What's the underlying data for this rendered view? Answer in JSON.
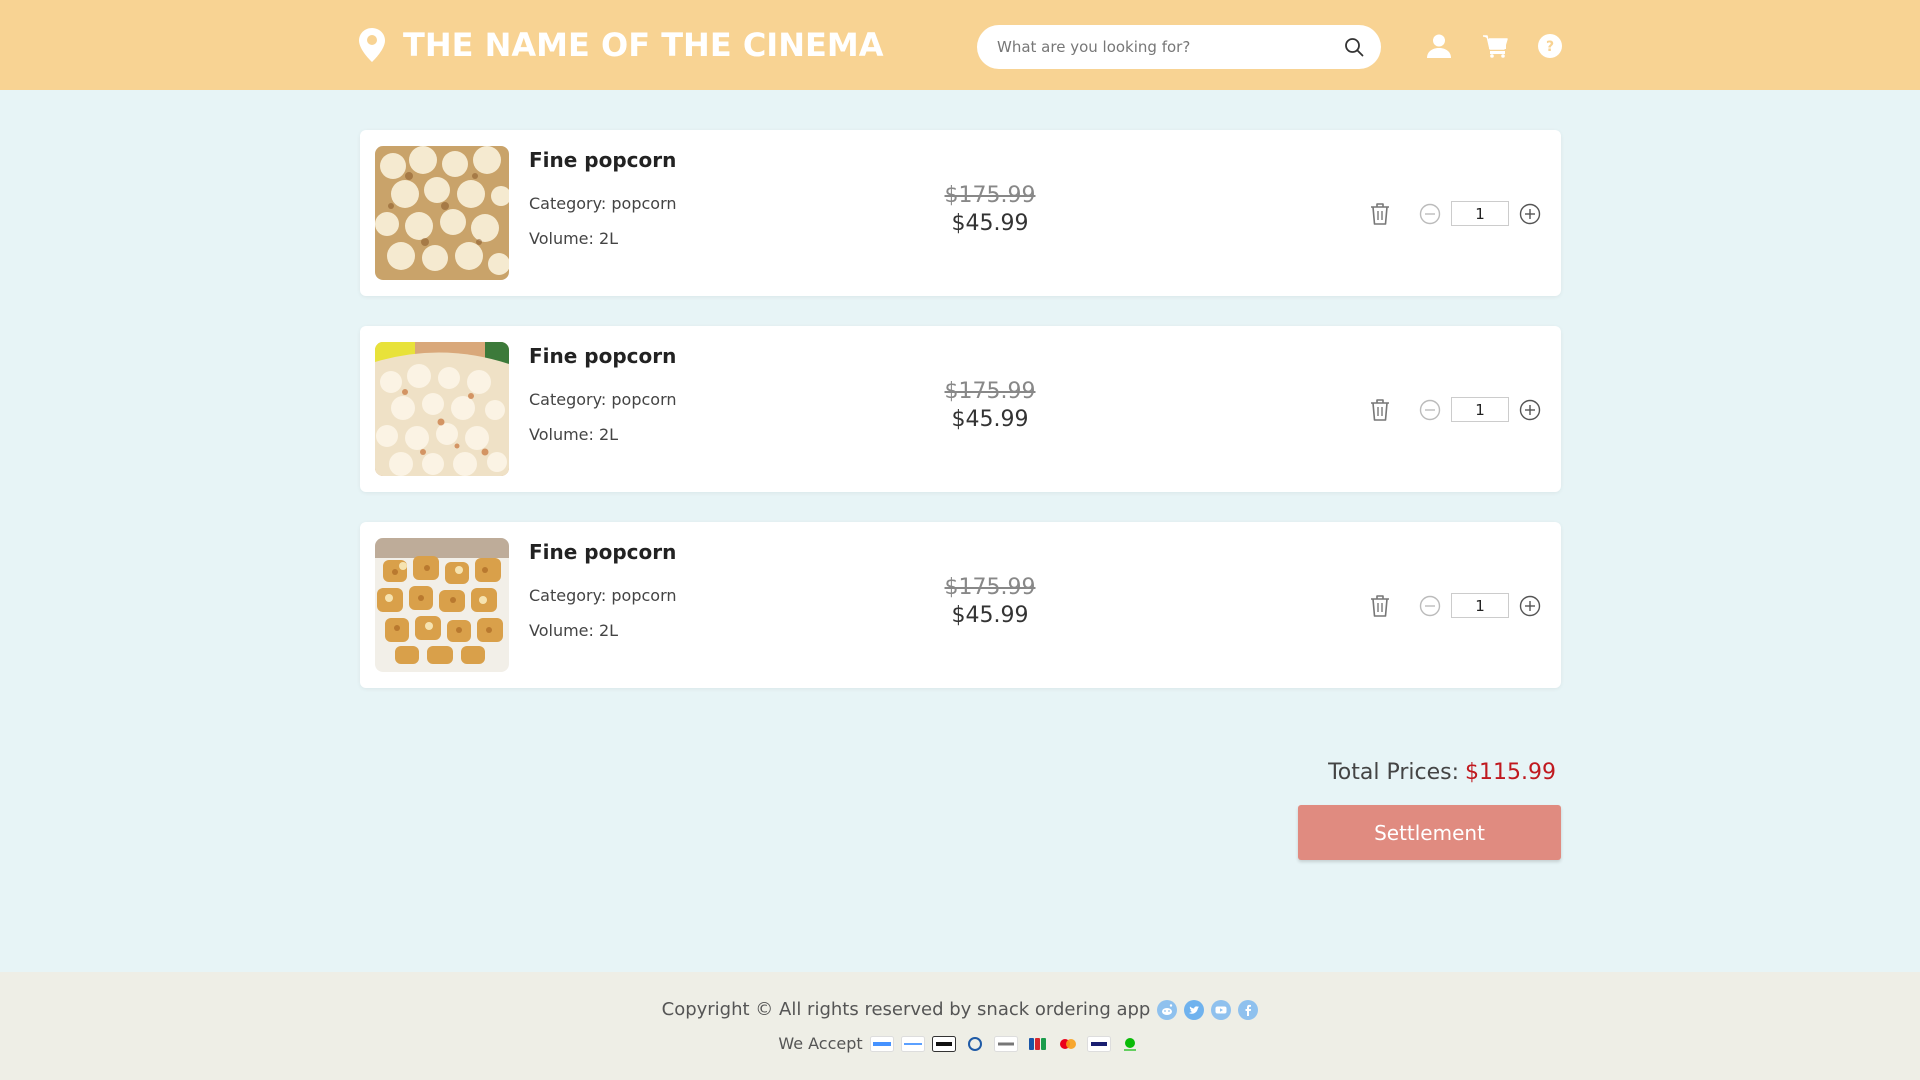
{
  "header": {
    "brand": "THE NAME OF THE CINEMA",
    "search_placeholder": "What are you looking for?",
    "search_value": "",
    "icons": [
      "location-pin-icon",
      "search-icon",
      "user-icon",
      "cart-icon",
      "help-icon"
    ],
    "background_color": "#f8d393"
  },
  "cart": {
    "items": [
      {
        "name": "Fine popcorn",
        "category": "Category: popcorn",
        "volume": "Volume: 2L",
        "original_price": "$175.99",
        "price": "$45.99",
        "quantity": "1"
      },
      {
        "name": "Fine popcorn",
        "category": "Category: popcorn",
        "volume": "Volume: 2L",
        "original_price": "$175.99",
        "price": "$45.99",
        "quantity": "1"
      },
      {
        "name": "Fine popcorn",
        "category": "Category: popcorn",
        "volume": "Volume: 2L",
        "original_price": "$175.99",
        "price": "$45.99",
        "quantity": "1"
      }
    ],
    "item_icons": [
      "trash-icon",
      "minus-circle-icon",
      "plus-circle-icon"
    ]
  },
  "summary": {
    "total_label": "Total Prices:",
    "total_value": "$115.99",
    "total_color": "#c0191f",
    "settle_label": "Settlement",
    "settle_color": "#e08b80"
  },
  "footer": {
    "copyright": "Copyright © All rights reserved by snack ordering app",
    "social_icons": [
      "reddit-icon",
      "twitter-icon",
      "youtube-icon",
      "facebook-icon"
    ],
    "accept_label": "We Accept",
    "payment_icons": [
      "alipay-cn-icon",
      "alipay-icon",
      "apple-pay-icon",
      "diners-icon",
      "google-pay-icon",
      "jcb-icon",
      "mastercard-icon",
      "visa-icon",
      "wechat-pay-icon"
    ]
  }
}
